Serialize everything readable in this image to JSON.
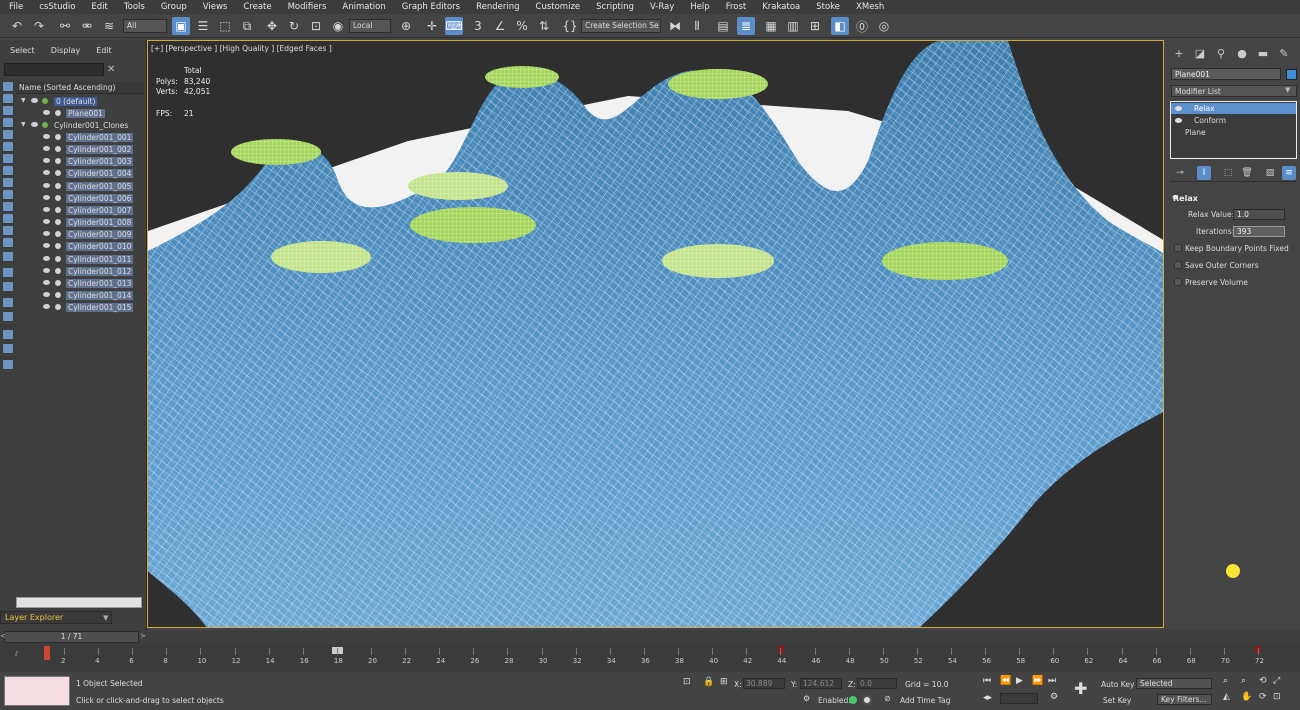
{
  "menu": [
    "File",
    "csStudio",
    "Edit",
    "Tools",
    "Group",
    "Views",
    "Create",
    "Modifiers",
    "Animation",
    "Graph Editors",
    "Rendering",
    "Customize",
    "Scripting",
    "V-Ray",
    "Help",
    "Frost",
    "Krakatoa",
    "Stoke",
    "XMesh"
  ],
  "toolbar": {
    "selection_filter": "All",
    "ref_coord": "Local",
    "named_selection": "Create Selection Se",
    "snap_label": "3"
  },
  "explorer": {
    "tabs": [
      "Select",
      "Display",
      "Edit"
    ],
    "header": "Name (Sorted Ascending)",
    "default_layer": "0 (default)",
    "plane": "Plane001",
    "clones_layer": "Cylinder001_Clones",
    "cylinders": [
      "Cylinder001_001",
      "Cylinder001_002",
      "Cylinder001_003",
      "Cylinder001_004",
      "Cylinder001_005",
      "Cylinder001_006",
      "Cylinder001_007",
      "Cylinder001_008",
      "Cylinder001_009",
      "Cylinder001_010",
      "Cylinder001_011",
      "Cylinder001_012",
      "Cylinder001_013",
      "Cylinder001_014",
      "Cylinder001_015"
    ],
    "layer_explorer": "Layer Explorer"
  },
  "viewport": {
    "label": "[+] [Perspective ] [High Quality ] [Edged Faces ]",
    "stats_total": "Total",
    "polys_label": "Polys:",
    "polys_value": "83,240",
    "verts_label": "Verts:",
    "verts_value": "42,051",
    "fps_label": "FPS:",
    "fps_value": "21",
    "surface_color": "#4f8fbf",
    "cap_color": "#a4d65a"
  },
  "command_panel": {
    "object_name": "Plane001",
    "object_color": "#3f8fd8",
    "modifier_list": "Modifier List",
    "stack": [
      "Relax",
      "Conform",
      "Plane"
    ],
    "rollout": "Relax",
    "relax_value_label": "Relax Value:",
    "relax_value": "1.0",
    "iterations_label": "Iterations:",
    "iterations": "393",
    "keep_boundary": "Keep Boundary Points Fixed",
    "save_outer": "Save Outer Corners",
    "preserve_volume": "Preserve Volume"
  },
  "timeline": {
    "thumb": "1 / 71",
    "ticks": [
      "2",
      "4",
      "6",
      "8",
      "10",
      "12",
      "14",
      "16",
      "18",
      "20",
      "22",
      "24",
      "26",
      "28",
      "30",
      "32",
      "34",
      "36",
      "38",
      "40",
      "42",
      "44",
      "46",
      "48",
      "50",
      "52",
      "54",
      "56",
      "58",
      "60",
      "62",
      "64",
      "66",
      "68",
      "70",
      "72"
    ]
  },
  "status": {
    "selected": "1 Object Selected",
    "prompt": "Click or click-and-drag to select objects",
    "x_label": "X:",
    "x_value": "30.889",
    "y_label": "Y:",
    "y_value": "124.612",
    "z_label": "Z:",
    "z_value": "0.0",
    "grid": "Grid = 10.0",
    "enabled": "Enabled:",
    "add_time_tag": "Add Time Tag",
    "auto_key": "Auto Key",
    "set_key": "Set Key",
    "key_mode": "Selected",
    "key_filters": "Key Filters..."
  }
}
